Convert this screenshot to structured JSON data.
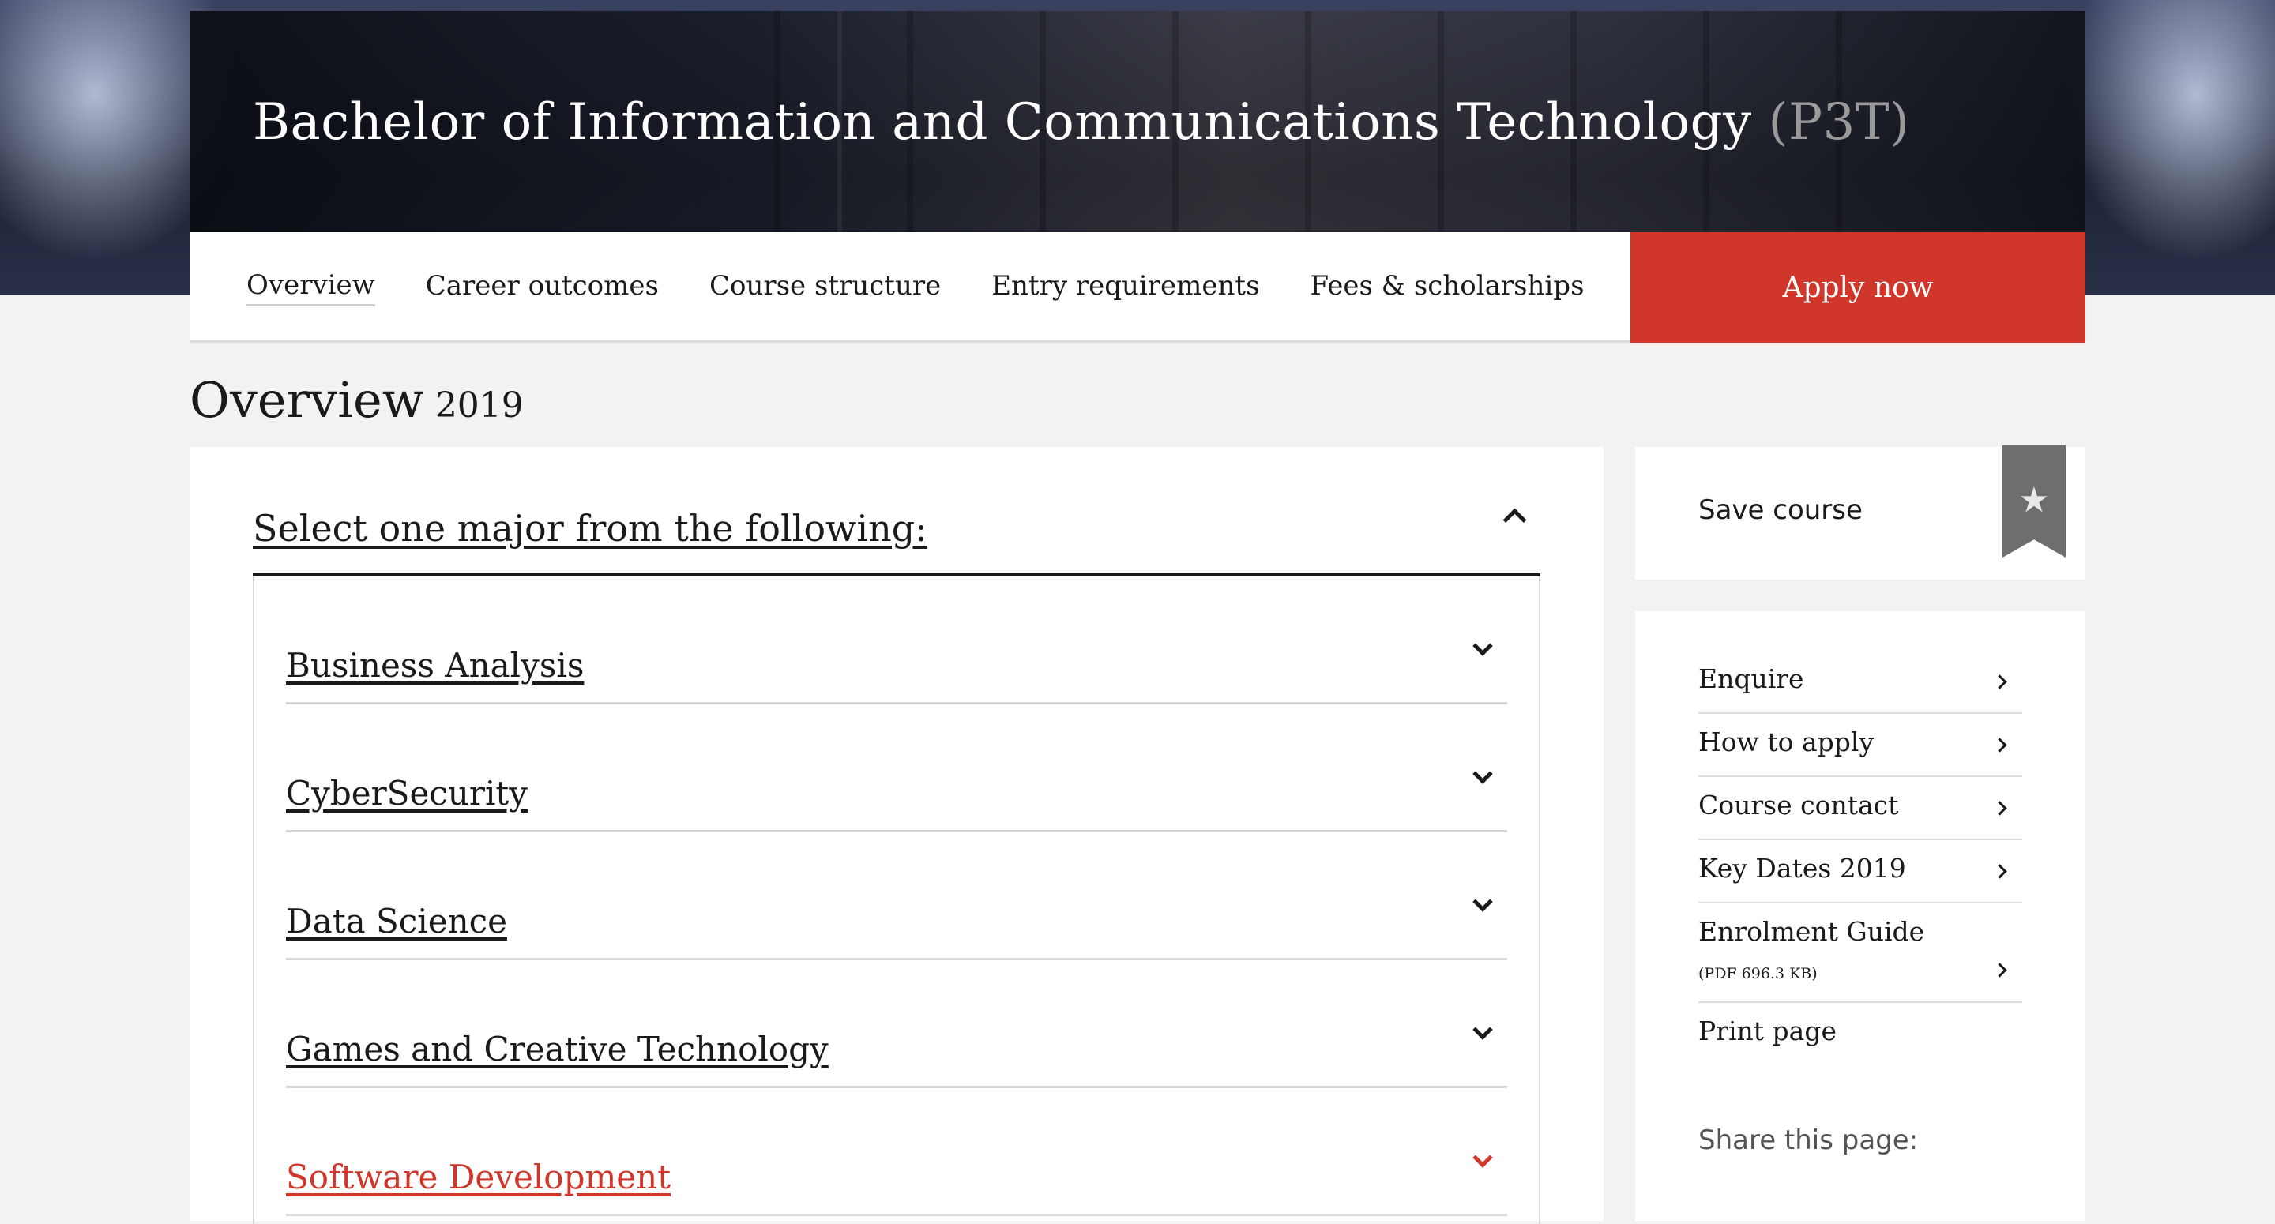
{
  "header": {
    "course_title": "Bachelor of Information and Communications Technology",
    "course_code": "(P3T)"
  },
  "nav": {
    "items": [
      {
        "label": "Overview",
        "active": true
      },
      {
        "label": "Career outcomes",
        "active": false
      },
      {
        "label": "Course structure",
        "active": false
      },
      {
        "label": "Entry requirements",
        "active": false
      },
      {
        "label": "Fees & scholarships",
        "active": false
      }
    ],
    "apply_label": "Apply now"
  },
  "page": {
    "heading": "Overview",
    "year": "2019"
  },
  "majors": {
    "title": "Select one major from the following:",
    "expanded": true,
    "items": [
      {
        "label": "Business Analysis",
        "highlighted": false
      },
      {
        "label": "CyberSecurity",
        "highlighted": false
      },
      {
        "label": "Data Science",
        "highlighted": false
      },
      {
        "label": "Games and Creative Technology",
        "highlighted": false
      },
      {
        "label": "Software Development",
        "highlighted": true
      }
    ]
  },
  "sidebar": {
    "save_label": "Save course",
    "links": [
      {
        "label": "Enquire"
      },
      {
        "label": "How to apply"
      },
      {
        "label": "Course contact"
      },
      {
        "label": "Key Dates 2019"
      },
      {
        "label": "Enrolment Guide",
        "sub": "(PDF 696.3 KB)"
      },
      {
        "label": "Print page"
      }
    ],
    "share_label": "Share this page:"
  },
  "colors": {
    "accent": "#d0362a",
    "background": "#f2f2f2",
    "bookmark": "#6e6e6e"
  },
  "icons": {
    "collapse": "chevron-up-icon",
    "expand": "chevron-down-icon",
    "link": "chevron-right-icon",
    "save": "bookmark-star-icon"
  }
}
